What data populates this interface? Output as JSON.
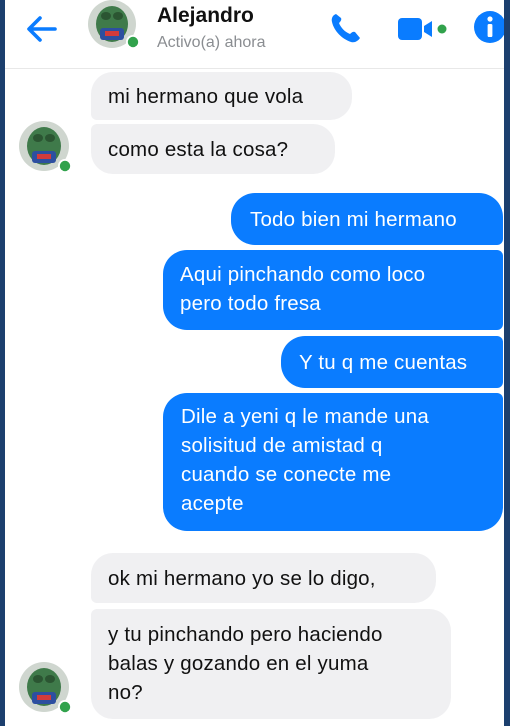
{
  "header": {
    "name": "Alejandro",
    "status": "Activo(a) ahora",
    "accent_color": "#0a7cff",
    "online_color": "#31a24c",
    "icons": [
      "back-arrow-icon",
      "phone-icon",
      "video-camera-icon",
      "info-icon"
    ]
  },
  "messages": [
    {
      "direction": "in",
      "text": "mi hermano que vola"
    },
    {
      "direction": "in",
      "text": "como esta la cosa?"
    },
    {
      "direction": "out",
      "text": "Todo bien mi hermano"
    },
    {
      "direction": "out",
      "lines": [
        "Aqui pinchando como loco",
        "pero todo fresa"
      ]
    },
    {
      "direction": "out",
      "text": "Y tu q me cuentas"
    },
    {
      "direction": "out",
      "lines": [
        "Dile a yeni q le mande una",
        "solisitud de amistad q",
        "cuando se conecte me",
        "acepte"
      ]
    },
    {
      "direction": "in",
      "text": "ok mi hermano yo se lo digo,"
    },
    {
      "direction": "in",
      "lines": [
        "y tu pinchando pero haciendo",
        "balas y gozando en el yuma",
        "no?"
      ]
    }
  ],
  "colors": {
    "incoming_bubble": "#f0f0f2",
    "outgoing_bubble": "#0a7cff",
    "background": "#1c3f6e"
  }
}
